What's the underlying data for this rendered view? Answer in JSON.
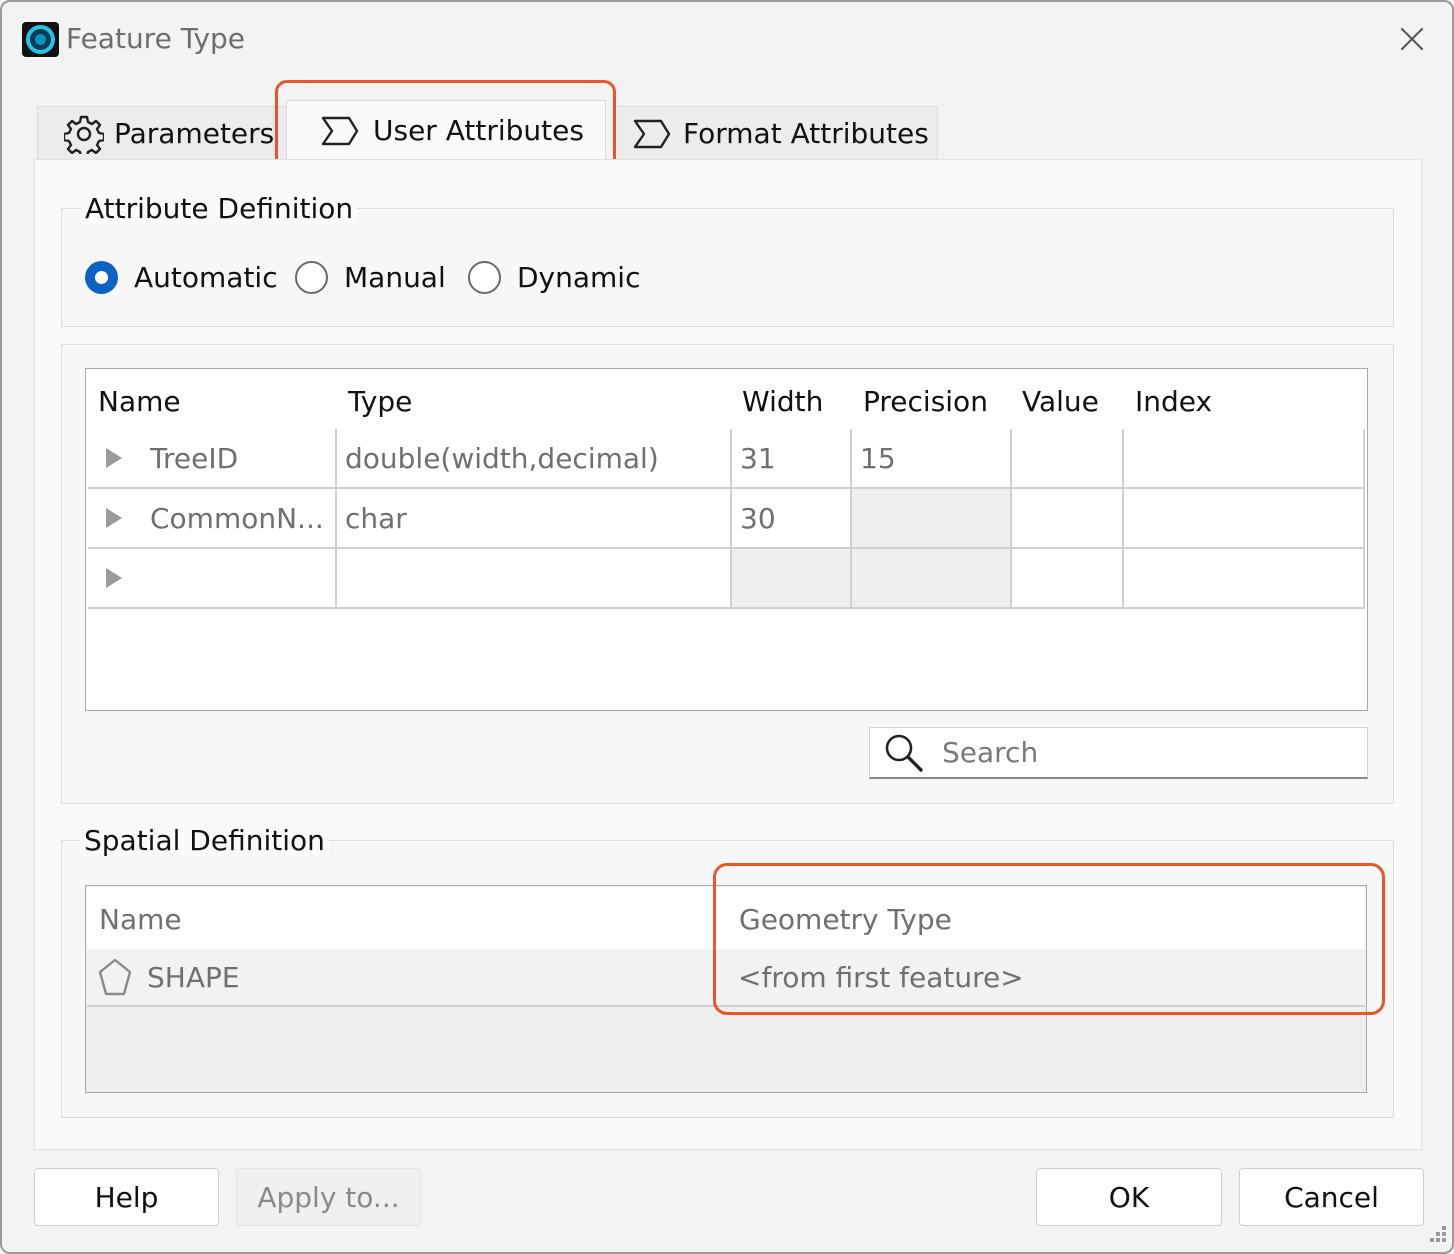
{
  "window": {
    "title": "Feature Type"
  },
  "tabs": [
    {
      "label": "Parameters",
      "icon": "gear-icon"
    },
    {
      "label": "User Attributes",
      "icon": "chevron-tag-icon",
      "active": true
    },
    {
      "label": "Format Attributes",
      "icon": "chevron-tag-icon"
    }
  ],
  "attribute_definition": {
    "title": "Attribute Definition",
    "options": [
      {
        "label": "Automatic",
        "selected": true
      },
      {
        "label": "Manual",
        "selected": false
      },
      {
        "label": "Dynamic",
        "selected": false
      }
    ]
  },
  "attributes_table": {
    "columns": [
      "Name",
      "Type",
      "Width",
      "Precision",
      "Value",
      "Index"
    ],
    "rows": [
      {
        "name": "TreeID",
        "type": "double(width,decimal)",
        "width": "31",
        "precision": "15",
        "value": "",
        "index": ""
      },
      {
        "name": "CommonN...",
        "type": "char",
        "width": "30",
        "precision": "",
        "value": "",
        "index": ""
      },
      {
        "name": "",
        "type": "",
        "width": "",
        "precision": "",
        "value": "",
        "index": ""
      }
    ]
  },
  "search": {
    "placeholder": "Search"
  },
  "spatial_definition": {
    "title": "Spatial Definition",
    "columns": [
      "Name",
      "Geometry Type"
    ],
    "rows": [
      {
        "name": "SHAPE",
        "geometry_type": "<from first feature>",
        "icon": "polygon-icon"
      }
    ]
  },
  "buttons": {
    "help": "Help",
    "apply_to": "Apply to...",
    "ok": "OK",
    "cancel": "Cancel"
  },
  "colors": {
    "highlight": "#e8562a",
    "radio_selected": "#0b62c4"
  }
}
